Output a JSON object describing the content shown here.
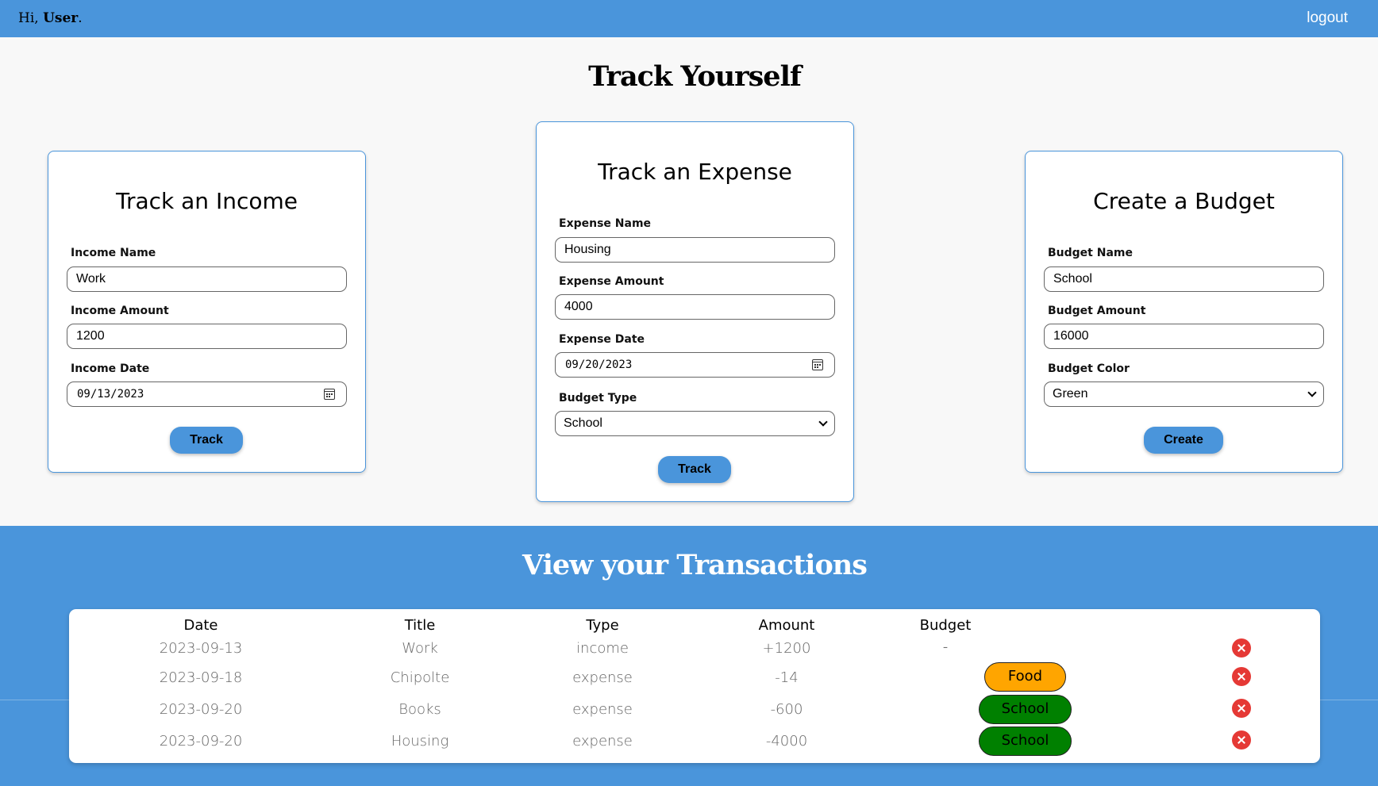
{
  "header": {
    "greeting_prefix": "Hi, ",
    "user_name": "User",
    "greeting_suffix": ".",
    "logout_label": "logout"
  },
  "page_title": "Track Yourself",
  "income_form": {
    "title": "Track an Income",
    "name_label": "Income Name",
    "name_value": "Work",
    "amount_label": "Income Amount",
    "amount_value": "1200",
    "date_label": "Income Date",
    "date_value": "09/13/2023",
    "submit_label": "Track"
  },
  "expense_form": {
    "title": "Track an Expense",
    "name_label": "Expense Name",
    "name_value": "Housing",
    "amount_label": "Expense Amount",
    "amount_value": "4000",
    "date_label": "Expense Date",
    "date_value": "09/20/2023",
    "budget_type_label": "Budget Type",
    "budget_type_value": "School",
    "submit_label": "Track"
  },
  "budget_form": {
    "title": "Create a Budget",
    "name_label": "Budget Name",
    "name_value": "School",
    "amount_label": "Budget Amount",
    "amount_value": "16000",
    "color_label": "Budget Color",
    "color_value": "Green",
    "submit_label": "Create"
  },
  "transactions": {
    "title": "View your Transactions",
    "columns": [
      "Date",
      "Title",
      "Type",
      "Amount",
      "Budget"
    ],
    "rows": [
      {
        "date": "2023-09-13",
        "title": "Work",
        "type": "income",
        "amount": "+1200",
        "budget": "-"
      },
      {
        "date": "2023-09-18",
        "title": "Chipolte",
        "type": "expense",
        "amount": "-14",
        "budget": "Food"
      },
      {
        "date": "2023-09-20",
        "title": "Books",
        "type": "expense",
        "amount": "-600",
        "budget": "School"
      },
      {
        "date": "2023-09-20",
        "title": "Housing",
        "type": "expense",
        "amount": "-4000",
        "budget": "School"
      }
    ]
  },
  "colors": {
    "accent": "#4a95db",
    "food_budget": "#ffa500",
    "school_budget": "#008000",
    "delete": "#e53935"
  },
  "icons": {
    "date_picker": "calendar-icon",
    "select": "chevron-down-icon",
    "delete": "delete-x-icon"
  }
}
